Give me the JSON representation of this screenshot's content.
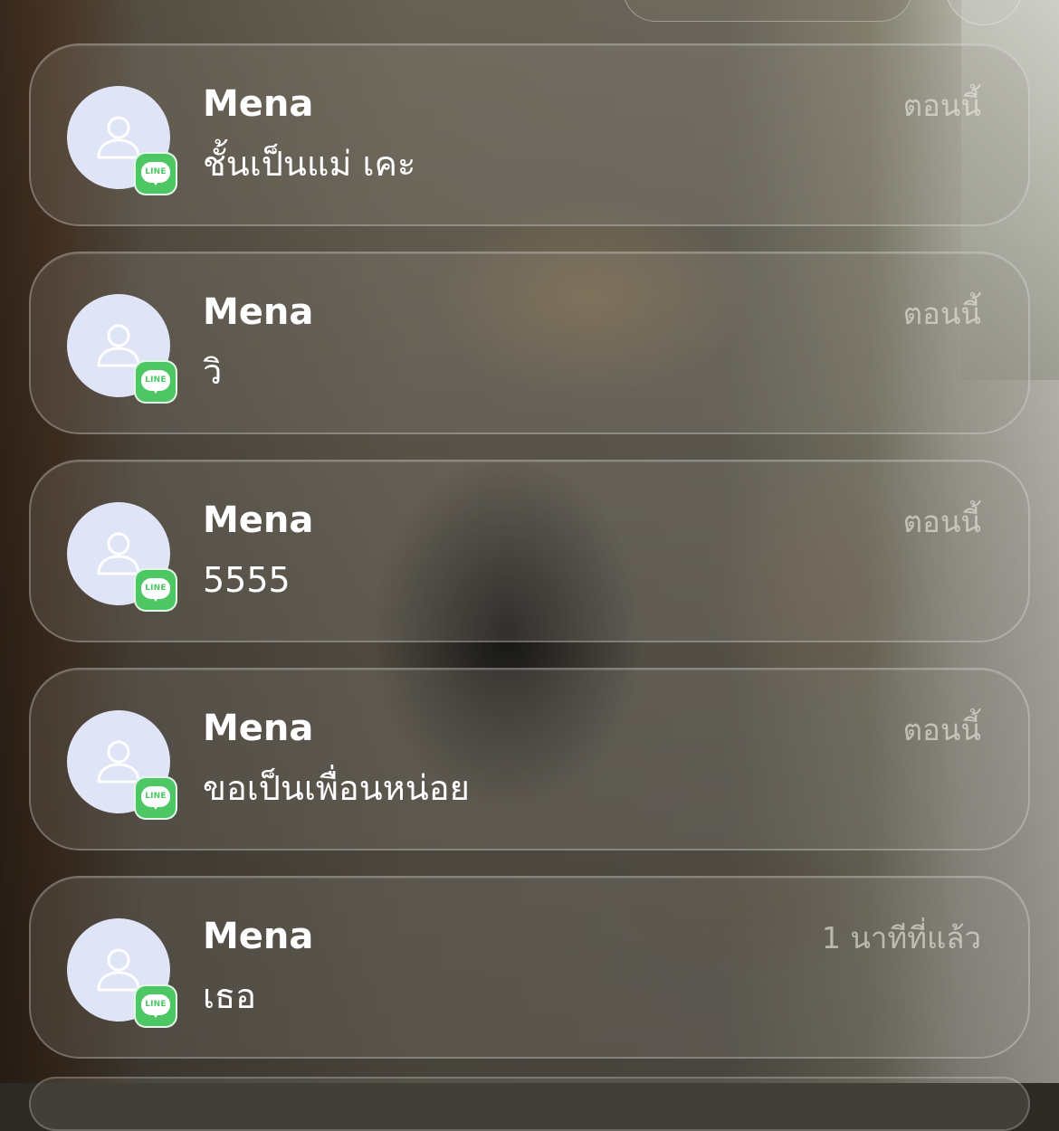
{
  "app": {
    "name": "LINE",
    "badge_label": "LINE",
    "accent_color": "#4cc764",
    "icon": "line-app-icon"
  },
  "notifications": [
    {
      "sender": "Mena",
      "message": "ชั้นเป็นแม่ เคะ",
      "time": "ตอนนี้",
      "avatar_icon": "person-placeholder-icon"
    },
    {
      "sender": "Mena",
      "message": "วิ",
      "time": "ตอนนี้",
      "avatar_icon": "person-placeholder-icon"
    },
    {
      "sender": "Mena",
      "message": "5555",
      "time": "ตอนนี้",
      "avatar_icon": "person-placeholder-icon"
    },
    {
      "sender": "Mena",
      "message": "ขอเป็นเพื่อนหน่อย",
      "time": "ตอนนี้",
      "avatar_icon": "person-placeholder-icon"
    },
    {
      "sender": "Mena",
      "message": "เธอ",
      "time": "1 นาทีที่แล้ว",
      "avatar_icon": "person-placeholder-icon"
    }
  ]
}
